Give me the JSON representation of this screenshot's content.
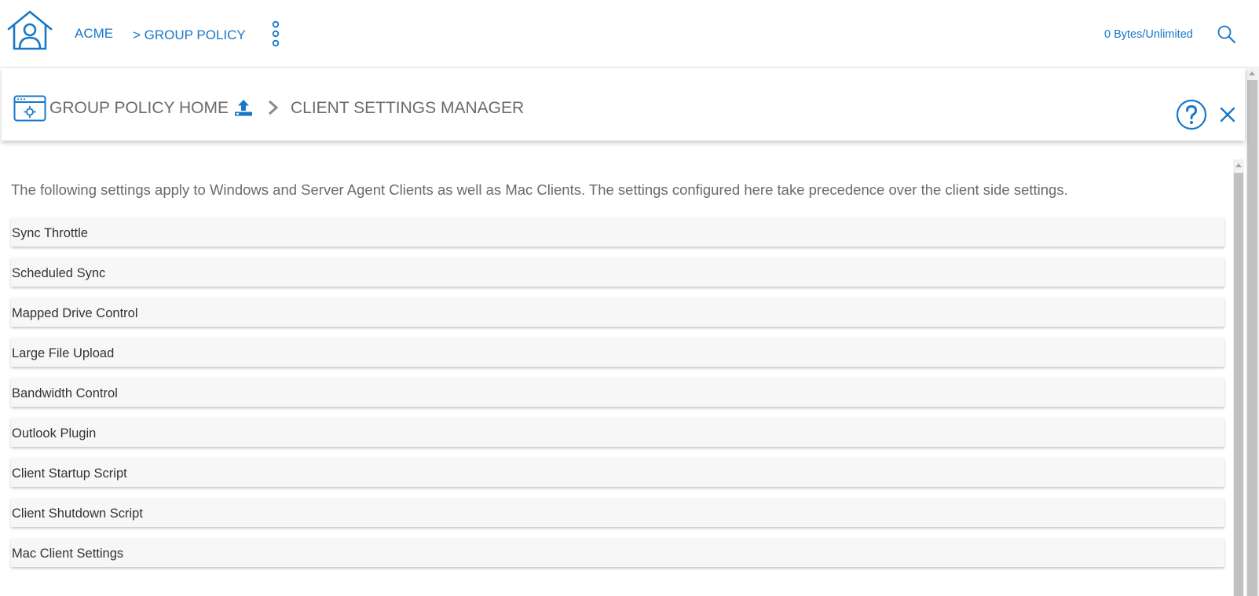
{
  "header": {
    "breadcrumb_root": "ACME",
    "breadcrumb_current": "> GROUP POLICY",
    "storage_usage": "0 Bytes/Unlimited"
  },
  "panel": {
    "home_label": "GROUP POLICY HOME",
    "title": "CLIENT SETTINGS MANAGER"
  },
  "content": {
    "description": "The following settings apply to Windows and Server Agent Clients as well as Mac Clients. The settings configured here take precedence over the client side settings.",
    "settings": [
      {
        "label": "Sync Throttle"
      },
      {
        "label": "Scheduled Sync"
      },
      {
        "label": "Mapped Drive Control"
      },
      {
        "label": "Large File Upload"
      },
      {
        "label": "Bandwidth Control"
      },
      {
        "label": "Outlook Plugin"
      },
      {
        "label": "Client Startup Script"
      },
      {
        "label": "Client Shutdown Script"
      },
      {
        "label": "Mac Client Settings"
      }
    ]
  },
  "icons": {
    "home": "home-user-icon",
    "menu": "vertical-dots-icon",
    "search": "search-icon",
    "policy": "browser-settings-icon",
    "upload": "upload-icon",
    "separator": "chevron-right-icon",
    "help": "help-icon",
    "close": "close-icon"
  },
  "colors": {
    "accent": "#1777c9",
    "panel_text": "#6b6b6b",
    "row_background": "#f7f7f7"
  }
}
